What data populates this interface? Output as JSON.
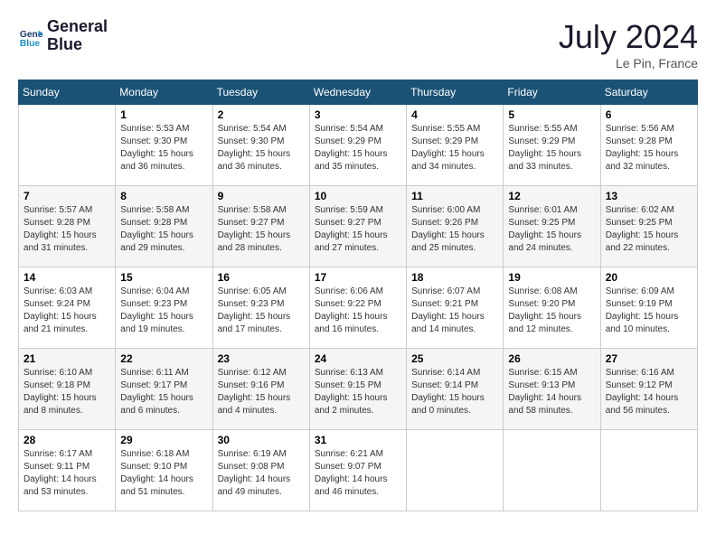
{
  "header": {
    "logo_line1": "General",
    "logo_line2": "Blue",
    "month": "July 2024",
    "location": "Le Pin, France"
  },
  "weekdays": [
    "Sunday",
    "Monday",
    "Tuesday",
    "Wednesday",
    "Thursday",
    "Friday",
    "Saturday"
  ],
  "weeks": [
    [
      {
        "day": "",
        "info": ""
      },
      {
        "day": "1",
        "info": "Sunrise: 5:53 AM\nSunset: 9:30 PM\nDaylight: 15 hours\nand 36 minutes."
      },
      {
        "day": "2",
        "info": "Sunrise: 5:54 AM\nSunset: 9:30 PM\nDaylight: 15 hours\nand 36 minutes."
      },
      {
        "day": "3",
        "info": "Sunrise: 5:54 AM\nSunset: 9:29 PM\nDaylight: 15 hours\nand 35 minutes."
      },
      {
        "day": "4",
        "info": "Sunrise: 5:55 AM\nSunset: 9:29 PM\nDaylight: 15 hours\nand 34 minutes."
      },
      {
        "day": "5",
        "info": "Sunrise: 5:55 AM\nSunset: 9:29 PM\nDaylight: 15 hours\nand 33 minutes."
      },
      {
        "day": "6",
        "info": "Sunrise: 5:56 AM\nSunset: 9:28 PM\nDaylight: 15 hours\nand 32 minutes."
      }
    ],
    [
      {
        "day": "7",
        "info": "Sunrise: 5:57 AM\nSunset: 9:28 PM\nDaylight: 15 hours\nand 31 minutes."
      },
      {
        "day": "8",
        "info": "Sunrise: 5:58 AM\nSunset: 9:28 PM\nDaylight: 15 hours\nand 29 minutes."
      },
      {
        "day": "9",
        "info": "Sunrise: 5:58 AM\nSunset: 9:27 PM\nDaylight: 15 hours\nand 28 minutes."
      },
      {
        "day": "10",
        "info": "Sunrise: 5:59 AM\nSunset: 9:27 PM\nDaylight: 15 hours\nand 27 minutes."
      },
      {
        "day": "11",
        "info": "Sunrise: 6:00 AM\nSunset: 9:26 PM\nDaylight: 15 hours\nand 25 minutes."
      },
      {
        "day": "12",
        "info": "Sunrise: 6:01 AM\nSunset: 9:25 PM\nDaylight: 15 hours\nand 24 minutes."
      },
      {
        "day": "13",
        "info": "Sunrise: 6:02 AM\nSunset: 9:25 PM\nDaylight: 15 hours\nand 22 minutes."
      }
    ],
    [
      {
        "day": "14",
        "info": "Sunrise: 6:03 AM\nSunset: 9:24 PM\nDaylight: 15 hours\nand 21 minutes."
      },
      {
        "day": "15",
        "info": "Sunrise: 6:04 AM\nSunset: 9:23 PM\nDaylight: 15 hours\nand 19 minutes."
      },
      {
        "day": "16",
        "info": "Sunrise: 6:05 AM\nSunset: 9:23 PM\nDaylight: 15 hours\nand 17 minutes."
      },
      {
        "day": "17",
        "info": "Sunrise: 6:06 AM\nSunset: 9:22 PM\nDaylight: 15 hours\nand 16 minutes."
      },
      {
        "day": "18",
        "info": "Sunrise: 6:07 AM\nSunset: 9:21 PM\nDaylight: 15 hours\nand 14 minutes."
      },
      {
        "day": "19",
        "info": "Sunrise: 6:08 AM\nSunset: 9:20 PM\nDaylight: 15 hours\nand 12 minutes."
      },
      {
        "day": "20",
        "info": "Sunrise: 6:09 AM\nSunset: 9:19 PM\nDaylight: 15 hours\nand 10 minutes."
      }
    ],
    [
      {
        "day": "21",
        "info": "Sunrise: 6:10 AM\nSunset: 9:18 PM\nDaylight: 15 hours\nand 8 minutes."
      },
      {
        "day": "22",
        "info": "Sunrise: 6:11 AM\nSunset: 9:17 PM\nDaylight: 15 hours\nand 6 minutes."
      },
      {
        "day": "23",
        "info": "Sunrise: 6:12 AM\nSunset: 9:16 PM\nDaylight: 15 hours\nand 4 minutes."
      },
      {
        "day": "24",
        "info": "Sunrise: 6:13 AM\nSunset: 9:15 PM\nDaylight: 15 hours\nand 2 minutes."
      },
      {
        "day": "25",
        "info": "Sunrise: 6:14 AM\nSunset: 9:14 PM\nDaylight: 15 hours\nand 0 minutes."
      },
      {
        "day": "26",
        "info": "Sunrise: 6:15 AM\nSunset: 9:13 PM\nDaylight: 14 hours\nand 58 minutes."
      },
      {
        "day": "27",
        "info": "Sunrise: 6:16 AM\nSunset: 9:12 PM\nDaylight: 14 hours\nand 56 minutes."
      }
    ],
    [
      {
        "day": "28",
        "info": "Sunrise: 6:17 AM\nSunset: 9:11 PM\nDaylight: 14 hours\nand 53 minutes."
      },
      {
        "day": "29",
        "info": "Sunrise: 6:18 AM\nSunset: 9:10 PM\nDaylight: 14 hours\nand 51 minutes."
      },
      {
        "day": "30",
        "info": "Sunrise: 6:19 AM\nSunset: 9:08 PM\nDaylight: 14 hours\nand 49 minutes."
      },
      {
        "day": "31",
        "info": "Sunrise: 6:21 AM\nSunset: 9:07 PM\nDaylight: 14 hours\nand 46 minutes."
      },
      {
        "day": "",
        "info": ""
      },
      {
        "day": "",
        "info": ""
      },
      {
        "day": "",
        "info": ""
      }
    ]
  ]
}
